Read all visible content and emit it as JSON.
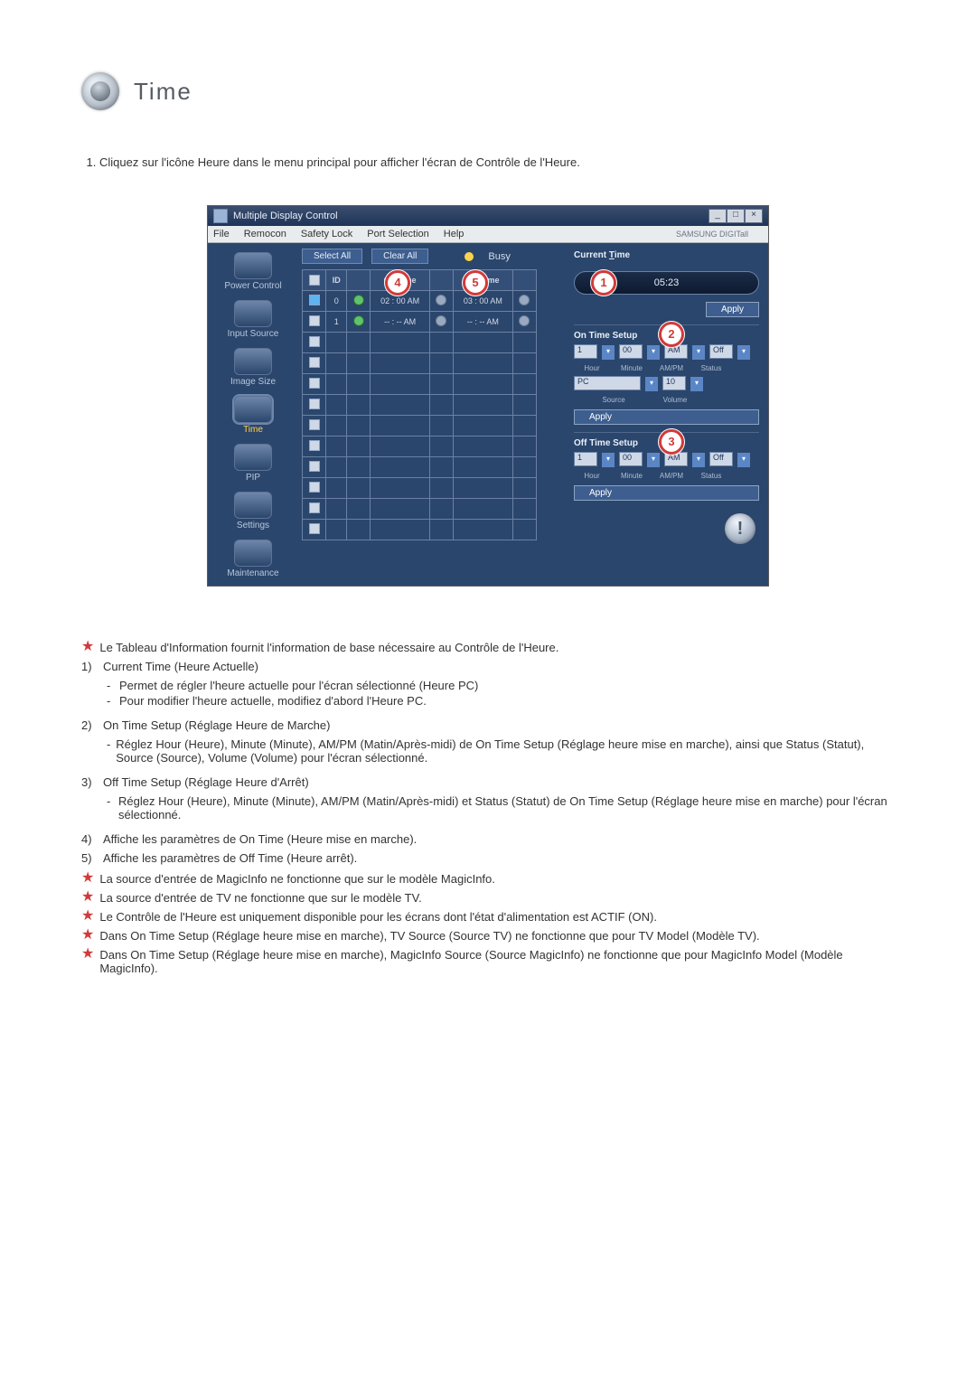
{
  "heading": {
    "title": "Time"
  },
  "intro_list": {
    "item1": "Cliquez sur l'icône Heure dans le menu principal pour afficher l'écran de Contrôle de l'Heure."
  },
  "app": {
    "window_title": "Multiple Display Control",
    "menus": {
      "file": "File",
      "remocon": "Remocon",
      "safety": "Safety Lock",
      "port": "Port Selection",
      "help": "Help"
    },
    "brand": "SAMSUNG DIGITall",
    "sidebar": {
      "items": [
        {
          "label": "Power Control"
        },
        {
          "label": "Input Source"
        },
        {
          "label": "Image Size"
        },
        {
          "label": "Time"
        },
        {
          "label": "PIP"
        },
        {
          "label": "Settings"
        },
        {
          "label": "Maintenance"
        }
      ]
    },
    "buttons": {
      "select_all": "Select All",
      "clear_all": "Clear All",
      "apply": "Apply"
    },
    "busy": "Busy",
    "table": {
      "headers": {
        "chk": "",
        "id": "ID",
        "st": "",
        "on": "On Time",
        "st2": "",
        "off": "Off Time",
        "st3": ""
      },
      "rows": [
        {
          "id": "0",
          "on": "02 : 00  AM",
          "off": "03 : 00  AM",
          "active": true,
          "led1": "on",
          "led2": "off",
          "led3": "off"
        },
        {
          "id": "1",
          "on": "-- : --  AM",
          "off": "-- : --  AM",
          "active": false,
          "led1": "on",
          "led2": "off",
          "led3": "off"
        }
      ]
    },
    "right": {
      "current_label": "Current Time",
      "current_value": "05:23",
      "on_setup_label": "On Time Setup",
      "on_setup": {
        "hour": "1",
        "min": "00",
        "ampm": "AM",
        "status": "Off",
        "source": "PC",
        "volume": "10"
      },
      "on_labels": {
        "hour": "Hour",
        "minute": "Minute",
        "ampm": "AM/PM",
        "status": "Status",
        "source": "Source",
        "volume": "Volume"
      },
      "off_setup_label": "Off Time Setup",
      "off_setup": {
        "hour": "1",
        "min": "00",
        "ampm": "AM",
        "status": "Off"
      },
      "off_labels": {
        "hour": "Hour",
        "minute": "Minute",
        "ampm": "AM/PM",
        "status": "Status"
      }
    },
    "badges": {
      "b1": "1",
      "b2": "2",
      "b3": "3",
      "b4": "4",
      "b5": "5"
    }
  },
  "notes": {
    "n0": "Le Tableau d'Information fournit l'information de base nécessaire au Contrôle de l'Heure.",
    "i1_title": "Current Time (Heure Actuelle)",
    "i1_a": "Permet de régler l'heure actuelle pour l'écran sélectionné (Heure PC)",
    "i1_b": "Pour modifier l'heure actuelle, modifiez d'abord l'Heure PC.",
    "i2_title": "On Time Setup (Réglage Heure de Marche)",
    "i2_a": "Réglez Hour (Heure), Minute (Minute), AM/PM (Matin/Après-midi) de On Time Setup (Réglage heure mise en marche), ainsi que Status (Statut), Source (Source), Volume (Volume) pour l'écran sélectionné.",
    "i3_title": "Off Time Setup (Réglage Heure d'Arrêt)",
    "i3_a": "Réglez Hour (Heure), Minute (Minute), AM/PM (Matin/Après-midi) et Status (Statut) de On Time Setup (Réglage heure mise en marche) pour l'écran sélectionné.",
    "i4": "Affiche les paramètres de On Time (Heure mise en marche).",
    "i5": "Affiche les paramètres de Off Time (Heure arrêt).",
    "s1": "La source d'entrée de MagicInfo ne fonctionne que sur le modèle MagicInfo.",
    "s2": "La source d'entrée de TV ne fonctionne que sur le modèle TV.",
    "s3": "Le Contrôle de l'Heure est uniquement disponible pour les écrans dont l'état d'alimentation est ACTIF (ON).",
    "s4": "Dans On Time Setup (Réglage heure mise en marche), TV Source (Source TV) ne fonctionne que pour TV Model (Modèle TV).",
    "s5": "Dans On Time Setup (Réglage heure mise en marche), MagicInfo Source (Source MagicInfo) ne fonctionne que pour MagicInfo Model (Modèle MagicInfo)."
  },
  "labels": {
    "one": "1)",
    "two": "2)",
    "three": "3)",
    "four": "4)",
    "five": "5)",
    "dash": "-"
  }
}
